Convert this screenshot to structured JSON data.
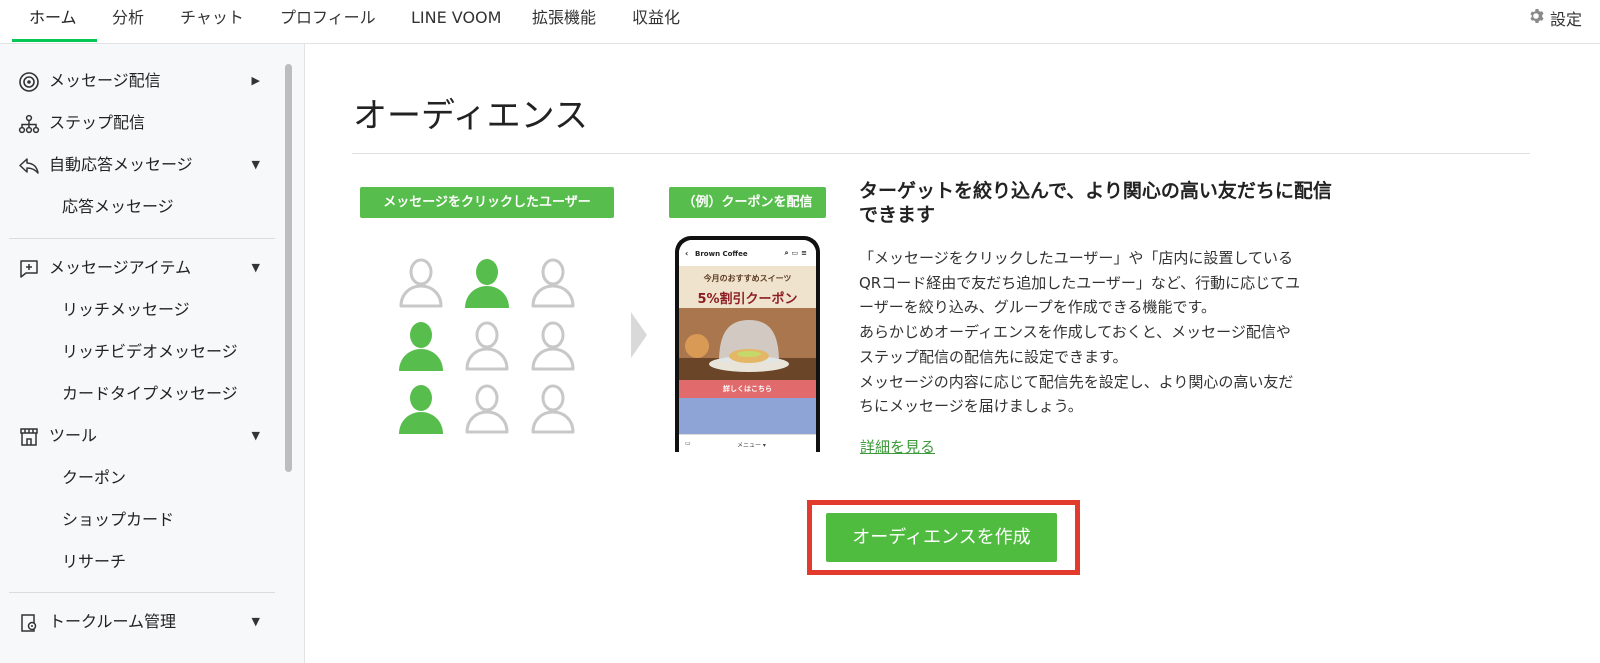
{
  "topnav": {
    "tabs": [
      {
        "label": "ホーム",
        "active": true
      },
      {
        "label": "分析"
      },
      {
        "label": "チャット"
      },
      {
        "label": "プロフィール"
      },
      {
        "label": "LINE VOOM"
      },
      {
        "label": "拡張機能"
      },
      {
        "label": "収益化"
      }
    ],
    "settings_label": "設定",
    "accent_color": "#06c755"
  },
  "sidebar": {
    "items": [
      {
        "label": "メッセージ配信",
        "icon": "broadcast-icon",
        "caret": "▶"
      },
      {
        "label": "ステップ配信",
        "icon": "hierarchy-icon"
      },
      {
        "label": "自動応答メッセージ",
        "icon": "reply-icon",
        "caret": "▼"
      },
      {
        "label": "応答メッセージ"
      },
      {
        "label": "メッセージアイテム",
        "icon": "message-plus-icon",
        "caret": "▼"
      },
      {
        "label": "リッチメッセージ"
      },
      {
        "label": "リッチビデオメッセージ"
      },
      {
        "label": "カードタイプメッセージ"
      },
      {
        "label": "ツール",
        "icon": "store-icon",
        "caret": "▼"
      },
      {
        "label": "クーポン"
      },
      {
        "label": "ショップカード"
      },
      {
        "label": "リサーチ"
      },
      {
        "label": "トークルーム管理",
        "icon": "chat-settings-icon",
        "caret": "▼"
      }
    ]
  },
  "main": {
    "title": "オーディエンス",
    "tag_left": "メッセージをクリックしたユーザー",
    "tag_right": "（例）クーポンを配信",
    "phone": {
      "account_name": "Brown Coffee",
      "banner_sub": "今月のおすすめスイーツ",
      "banner_title": "5%割引クーポン",
      "cta": "詳しくはこちら",
      "menu": "メニュー ▾"
    },
    "headline": "ターゲットを絞り込んで、より関心の高い友だちに配信できます",
    "paragraph_lines": [
      "「メッセージをクリックしたユーザー」や「店内に設置している",
      "QRコード経由で友だち追加したユーザー」など、行動に応じてユ",
      "ーザーを絞り込み、グループを作成できる機能です。",
      "あらかじめオーディエンスを作成しておくと、メッセージ配信や",
      "ステップ配信の配信先に設定できます。",
      "メッセージの内容に応じて配信先を設定し、より関心の高い友だ",
      "ちにメッセージを届けましょう。"
    ],
    "details_link": "詳細を見る",
    "create_button": "オーディエンスを作成",
    "highlight_color": "#e23b2e",
    "button_color": "#4fbb3f"
  }
}
